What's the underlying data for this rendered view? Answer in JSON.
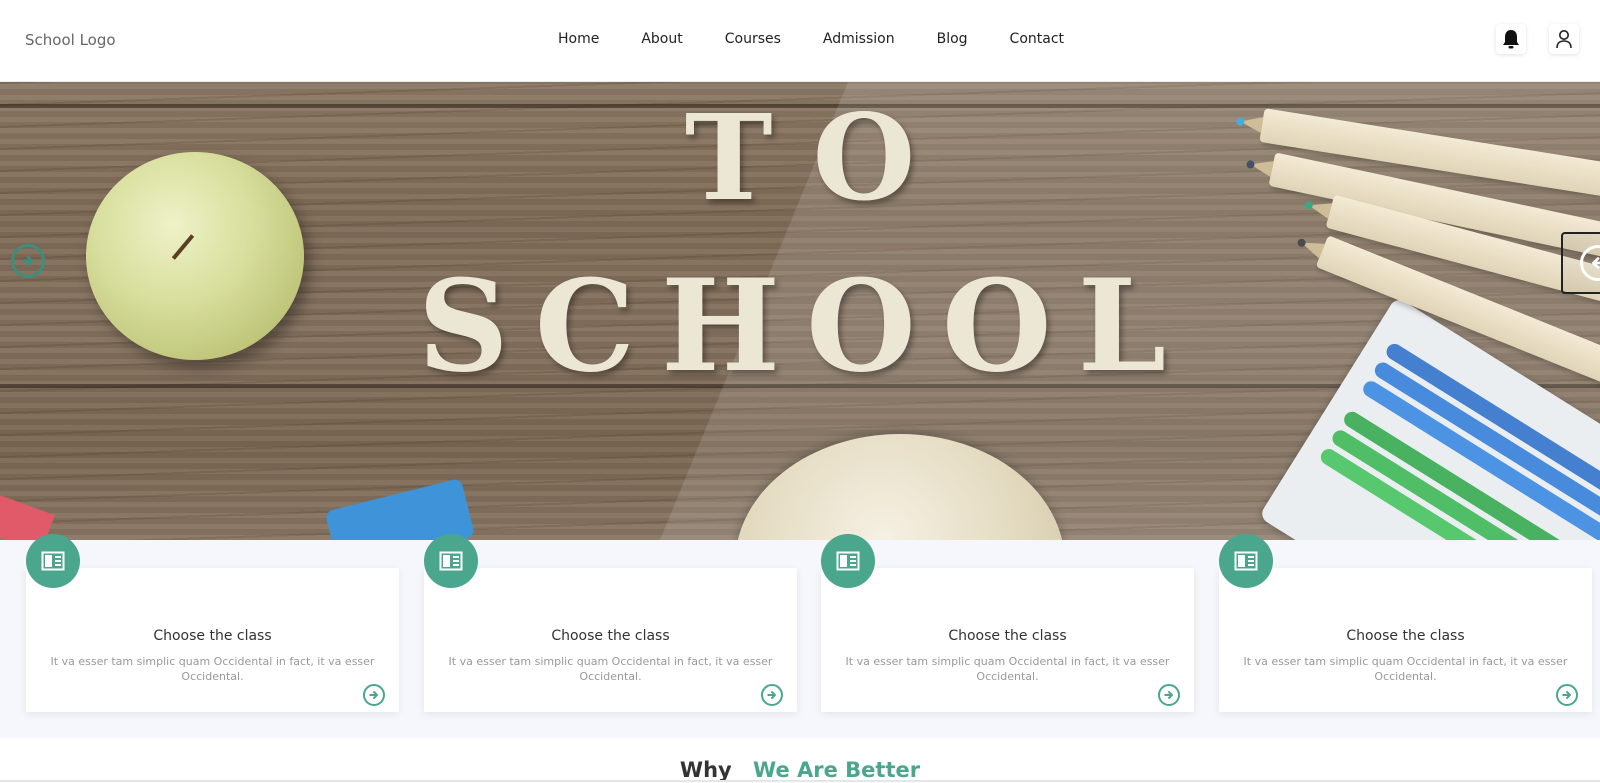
{
  "header": {
    "logo": "School Logo",
    "nav": [
      "Home",
      "About",
      "Courses",
      "Admission",
      "Blog",
      "Contact"
    ],
    "icons": [
      "bell-icon",
      "user-icon"
    ]
  },
  "hero": {
    "line1": "TO",
    "line2": "SCHOOL"
  },
  "features": {
    "cards": [
      {
        "title": "Choose the class",
        "desc": "It va esser tam simplic quam Occidental in fact, it va esser Occidental."
      },
      {
        "title": "Choose the class",
        "desc": "It va esser tam simplic quam Occidental in fact, it va esser Occidental."
      },
      {
        "title": "Choose the class",
        "desc": "It va esser tam simplic quam Occidental in fact, it va esser Occidental."
      },
      {
        "title": "Choose the class",
        "desc": "It va esser tam simplic quam Occidental in fact, it va esser Occidental."
      }
    ]
  },
  "why": {
    "part1": "Why",
    "part2": "We Are Better"
  },
  "colors": {
    "accent": "#4aa68d",
    "hero_arrow": "#3a8f7d",
    "section_bg": "#f6f7fc"
  }
}
